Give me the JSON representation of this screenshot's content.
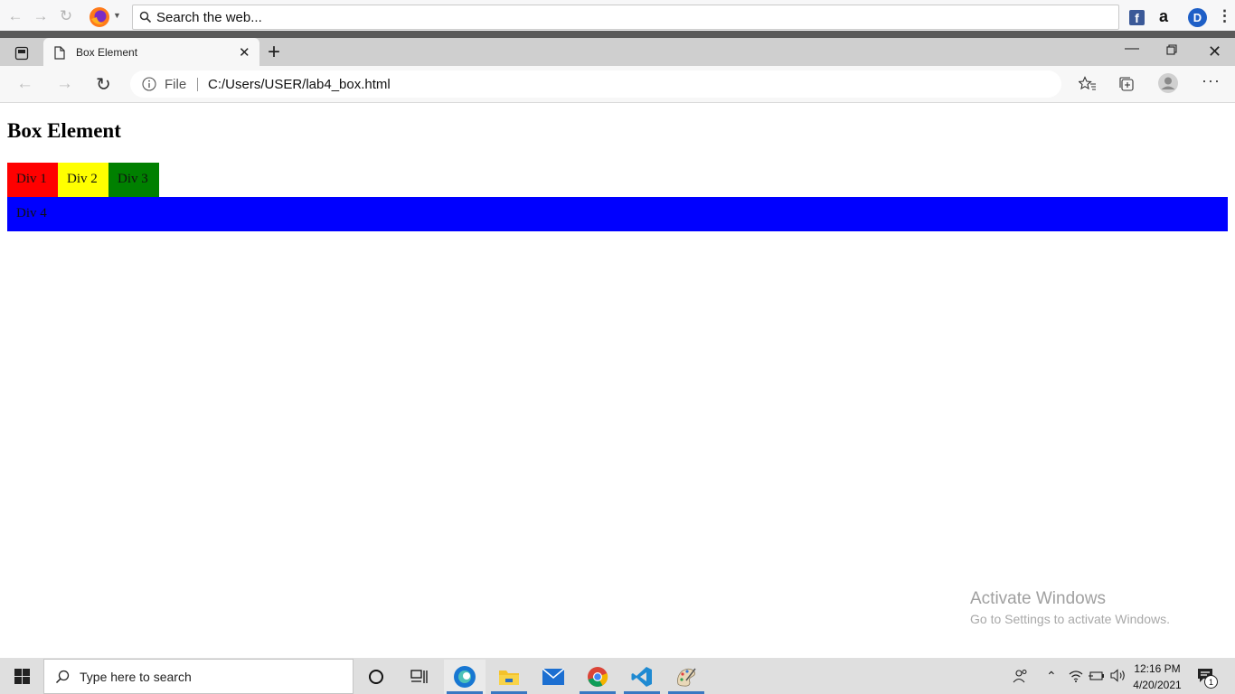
{
  "outer_toolbar": {
    "search_placeholder": "Search the web..."
  },
  "tab": {
    "title": "Box Element"
  },
  "address_bar": {
    "scheme_label": "File",
    "url": "C:/Users/USER/lab4_box.html"
  },
  "page": {
    "title": "Box Element",
    "boxes": [
      {
        "label": "Div 1",
        "color": "#ff0000"
      },
      {
        "label": "Div 2",
        "color": "#ffff00"
      },
      {
        "label": "Div 3",
        "color": "#008000"
      },
      {
        "label": "Div 4",
        "color": "#0000ff"
      }
    ]
  },
  "watermark": {
    "line1": "Activate Windows",
    "line2": "Go to Settings to activate Windows."
  },
  "taskbar": {
    "search_placeholder": "Type here to search",
    "time": "12:16 PM",
    "date": "4/20/2021",
    "notification_count": "1"
  }
}
